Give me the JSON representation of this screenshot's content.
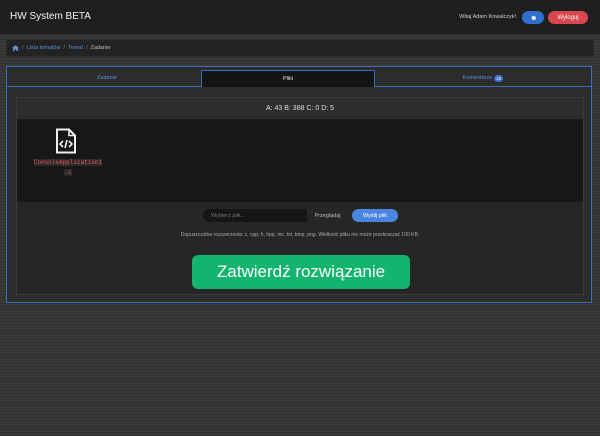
{
  "navbar": {
    "brand": "HW System BETA",
    "welcome": "Witaj Adam Kowalczyk!",
    "settings_icon": "gear-icon",
    "logout_label": "Wyloguj"
  },
  "breadcrumb": {
    "home_icon": "home-icon",
    "items": [
      "Lista tematów",
      "Temat",
      "Zadanie"
    ]
  },
  "tabs": [
    {
      "label": "Zadanie",
      "active": false
    },
    {
      "label": "Pliki",
      "active": true
    },
    {
      "label": "Komentarze",
      "active": false,
      "badge": "22"
    }
  ],
  "stats": "A: 43 B: 388 C: 0 D: 5",
  "files": [
    {
      "name_line1": "ConsoleApplication1",
      "name_line2": ".c",
      "icon": "code-file-icon"
    }
  ],
  "upload": {
    "placeholder": "Wybierz plik...",
    "browse_label": "Przeglądaj",
    "send_label": "Wyślij plik"
  },
  "note": "Dopuszczalne rozszerzenia: c, cpp, h, hpp, inc, txt, bmp, png. Wielkość pliku nie może przekraczać 100 KB.",
  "submit_label": "Zatwierdź rozwiązanie",
  "colors": {
    "accent_blue": "#3a6fc0",
    "success_green": "#13b56e",
    "danger_red": "#d9464f",
    "filename_red": "#ef5350"
  }
}
